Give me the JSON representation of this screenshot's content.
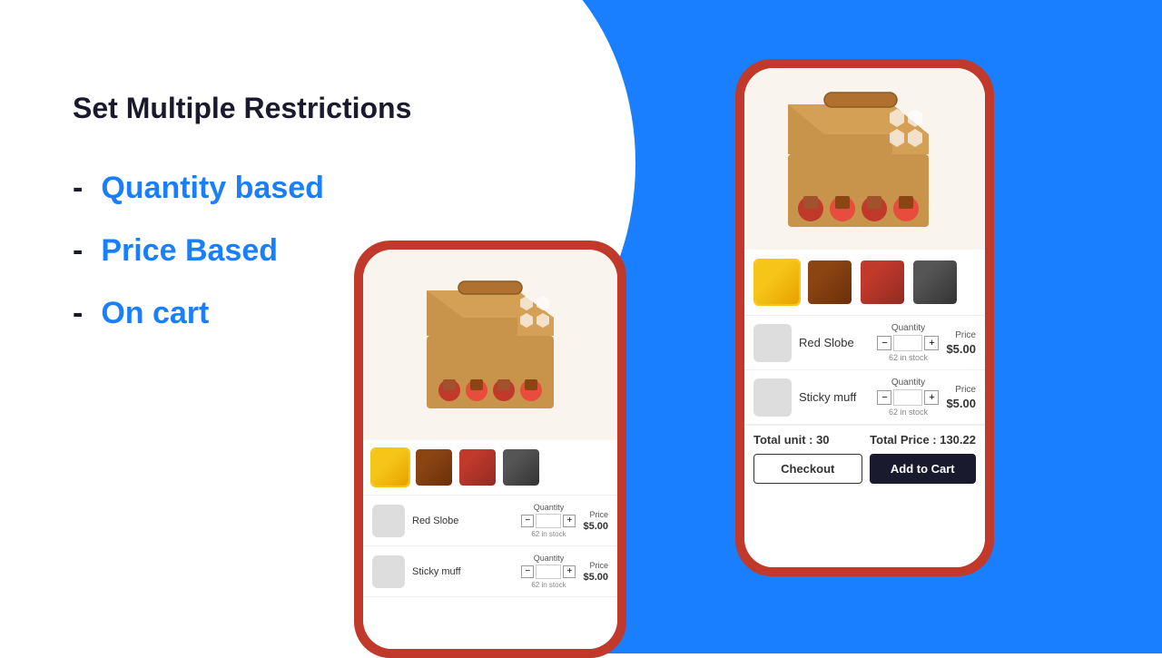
{
  "page": {
    "title": "Set Multiple Restrictions",
    "bullets": [
      {
        "dash": "-",
        "label": "Quantity based"
      },
      {
        "dash": "-",
        "label": "Price Based"
      },
      {
        "dash": "-",
        "label": "On cart"
      }
    ]
  },
  "phone_small": {
    "product_image_alt": "cupcake box",
    "thumbnails": [
      {
        "label": "yellow cupcake",
        "active": true
      },
      {
        "label": "brown cupcake",
        "active": false
      },
      {
        "label": "red cupcake",
        "active": false
      },
      {
        "label": "dark cupcake",
        "active": false
      }
    ],
    "products": [
      {
        "name": "Red Slobe",
        "qty_label": "Quantity",
        "qty_value": "",
        "stock": "62 in stock",
        "price_label": "Price",
        "price": "$5.00",
        "thumb_color": "brown"
      },
      {
        "name": "Sticky muff",
        "qty_label": "Quantity",
        "qty_value": "",
        "stock": "62 in stock",
        "price_label": "Price",
        "price": "$5.00",
        "thumb_color": "yellow"
      }
    ]
  },
  "phone_large": {
    "product_image_alt": "cupcake box large",
    "thumbnails": [
      {
        "label": "yellow cupcake",
        "active": true
      },
      {
        "label": "brown cupcake",
        "active": false
      },
      {
        "label": "red cupcake",
        "active": false
      },
      {
        "label": "dark cupcake",
        "active": false
      }
    ],
    "products": [
      {
        "name": "Red Slobe",
        "qty_label": "Quantity",
        "qty_value": "",
        "stock": "62 in stock",
        "price_label": "Price",
        "price": "$5.00",
        "thumb_color": "brown"
      },
      {
        "name": "Sticky muff",
        "qty_label": "Quantity",
        "qty_value": "",
        "stock": "62 in stock",
        "price_label": "Price",
        "price": "$5.00",
        "thumb_color": "yellow"
      }
    ],
    "footer": {
      "total_unit_label": "Total unit : 30",
      "total_price_label": "Total Price : 130.22",
      "checkout_btn": "Checkout",
      "addtocart_btn": "Add to Cart"
    }
  }
}
